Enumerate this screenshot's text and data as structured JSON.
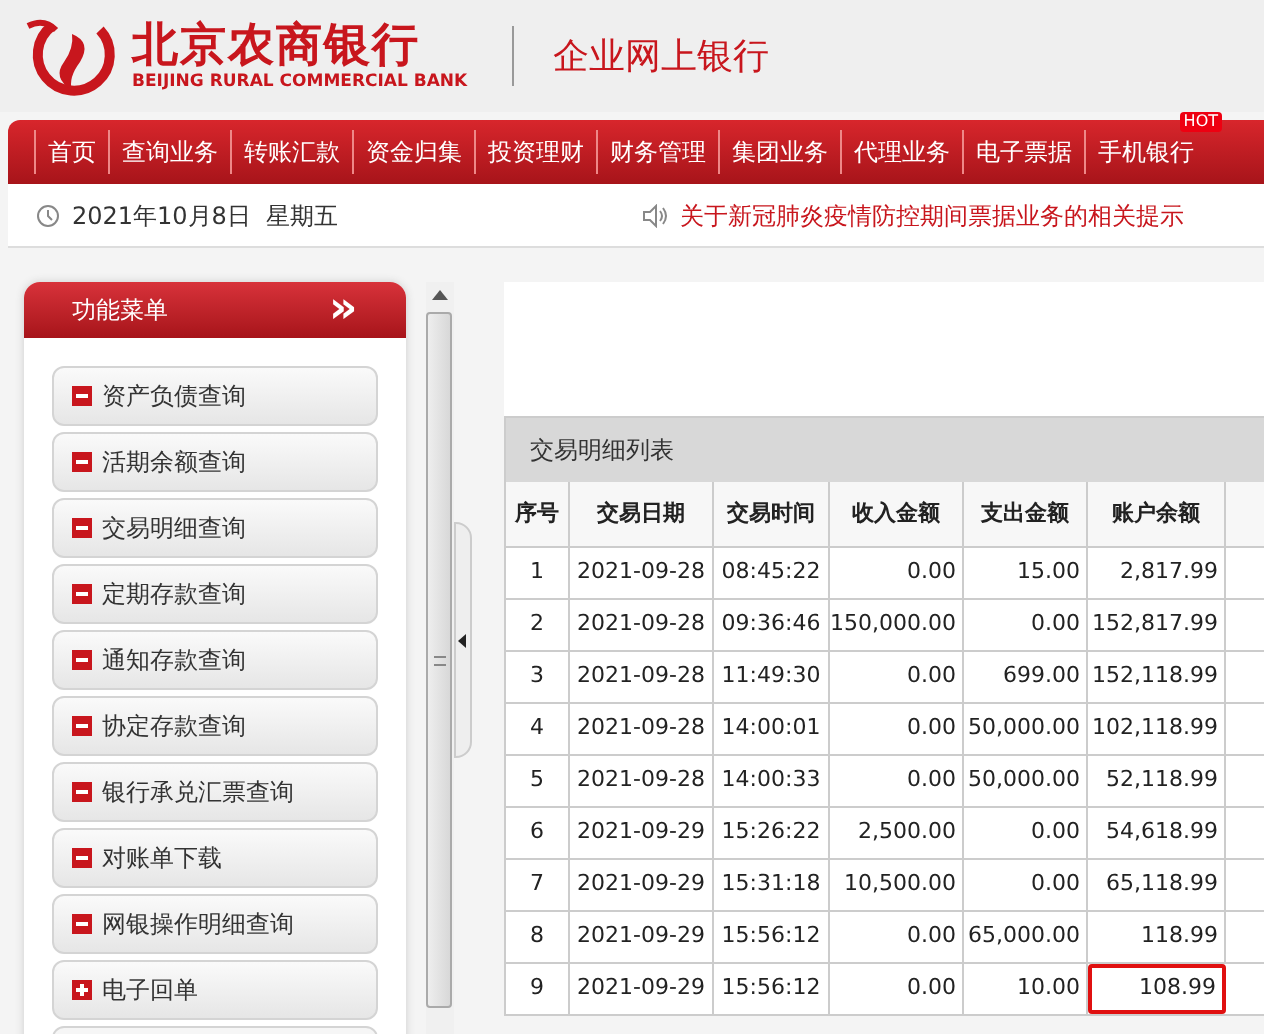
{
  "header": {
    "bank_name": "北京农商银行",
    "bank_name_en": "BEIJING RURAL COMMERCIAL BANK",
    "portal": "企业网上银行"
  },
  "nav": [
    {
      "label": "首页"
    },
    {
      "label": "查询业务"
    },
    {
      "label": "转账汇款"
    },
    {
      "label": "资金归集"
    },
    {
      "label": "投资理财"
    },
    {
      "label": "财务管理"
    },
    {
      "label": "集团业务"
    },
    {
      "label": "代理业务"
    },
    {
      "label": "电子票据"
    },
    {
      "label": "手机银行",
      "badge": "HOT"
    }
  ],
  "info_bar": {
    "date": "2021年10月8日  星期五",
    "notice": "关于新冠肺炎疫情防控期间票据业务的相关提示"
  },
  "sidebar": {
    "title": "功能菜单",
    "collapse": "»",
    "items": [
      {
        "label": "资产负债查询",
        "expanded": true
      },
      {
        "label": "活期余额查询",
        "expanded": true
      },
      {
        "label": "交易明细查询",
        "expanded": true
      },
      {
        "label": "定期存款查询",
        "expanded": true
      },
      {
        "label": "通知存款查询",
        "expanded": true
      },
      {
        "label": "协定存款查询",
        "expanded": true
      },
      {
        "label": "银行承兑汇票查询",
        "expanded": true
      },
      {
        "label": "对账单下载",
        "expanded": true
      },
      {
        "label": "网银操作明细查询",
        "expanded": true
      },
      {
        "label": "电子回单",
        "expanded": false
      }
    ]
  },
  "table": {
    "title": "交易明细列表",
    "columns": [
      "序号",
      "交易日期",
      "交易时间",
      "收入金额",
      "支出金额",
      "账户余额"
    ],
    "rows": [
      {
        "cells": [
          "1",
          "2021-09-28",
          "08:45:22",
          "0.00",
          "15.00",
          "2,817.99"
        ],
        "highlighted": false
      },
      {
        "cells": [
          "2",
          "2021-09-28",
          "09:36:46",
          "150,000.00",
          "0.00",
          "152,817.99"
        ],
        "highlighted": false
      },
      {
        "cells": [
          "3",
          "2021-09-28",
          "11:49:30",
          "0.00",
          "699.00",
          "152,118.99"
        ],
        "highlighted": false
      },
      {
        "cells": [
          "4",
          "2021-09-28",
          "14:00:01",
          "0.00",
          "50,000.00",
          "102,118.99"
        ],
        "highlighted": false
      },
      {
        "cells": [
          "5",
          "2021-09-28",
          "14:00:33",
          "0.00",
          "50,000.00",
          "52,118.99"
        ],
        "highlighted": false
      },
      {
        "cells": [
          "6",
          "2021-09-29",
          "15:26:22",
          "2,500.00",
          "0.00",
          "54,618.99"
        ],
        "highlighted": false
      },
      {
        "cells": [
          "7",
          "2021-09-29",
          "15:31:18",
          "10,500.00",
          "0.00",
          "65,118.99"
        ],
        "highlighted": false
      },
      {
        "cells": [
          "8",
          "2021-09-29",
          "15:56:12",
          "0.00",
          "65,000.00",
          "118.99"
        ],
        "highlighted": false
      },
      {
        "cells": [
          "9",
          "2021-09-29",
          "15:56:12",
          "0.00",
          "10.00",
          "108.99"
        ],
        "highlighted": true
      }
    ]
  }
}
